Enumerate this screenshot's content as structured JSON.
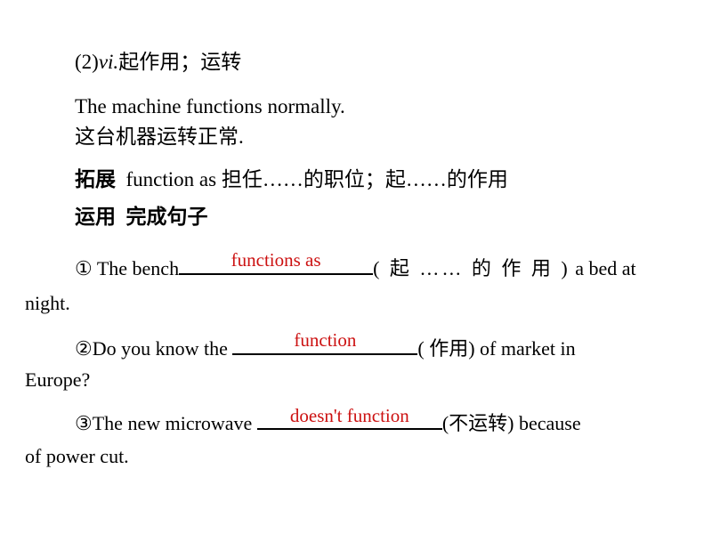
{
  "document": {
    "accent_color": "#cc1111",
    "background_color": "#ffffff",
    "text_color": "#000000"
  },
  "entry": {
    "sense_number": "(2)",
    "part_of_speech": "vi.",
    "definition": "起作用；运转",
    "example_en": "The machine functions normally.",
    "example_cn": "这台机器运转正常."
  },
  "extend": {
    "label": "拓展",
    "phrase": "function as",
    "meaning": "担任……的职位；起……的作用"
  },
  "apply": {
    "label": "运用",
    "title": "完成句子"
  },
  "exercises": [
    {
      "marker": "①",
      "before": "The bench",
      "answer": "functions as",
      "hint": "( 起 …… 的 作 用 )",
      "after": " a bed at",
      "continuation": "night."
    },
    {
      "marker": "②",
      "before": "Do you know the ",
      "answer": "function",
      "hint": "( 作用)",
      "after": " of market in",
      "continuation": "Europe?"
    },
    {
      "marker": "③",
      "before": "The new microwave ",
      "answer": "doesn't function",
      "hint": "(不运转)",
      "after": " because",
      "continuation": "of power cut."
    }
  ]
}
